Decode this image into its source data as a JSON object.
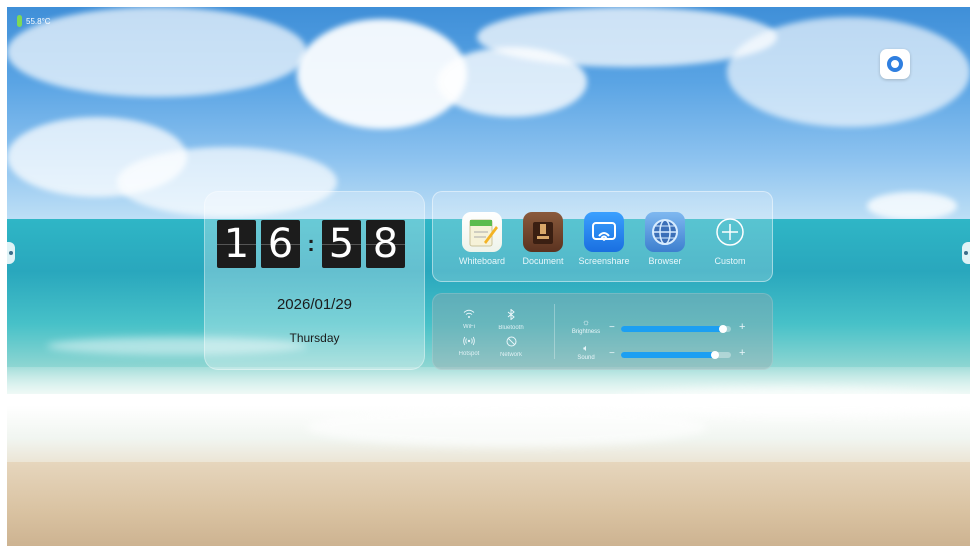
{
  "status": {
    "temperature": "55.8°C"
  },
  "clock": {
    "h1": "1",
    "h2": "6",
    "colon": ":",
    "m1": "5",
    "m2": "8",
    "date": "2026/01/29",
    "weekday": "Thursday"
  },
  "apps": [
    {
      "label": "Whiteboard",
      "icon": "whiteboard-icon"
    },
    {
      "label": "Document",
      "icon": "document-icon"
    },
    {
      "label": "Screenshare",
      "icon": "screenshare-icon"
    },
    {
      "label": "Browser",
      "icon": "browser-icon"
    },
    {
      "label": "Custom",
      "icon": "add-icon"
    }
  ],
  "quick_settings": [
    {
      "label": "WiFi",
      "icon": "wifi-icon"
    },
    {
      "label": "Bluetooth",
      "icon": "bluetooth-icon"
    },
    {
      "label": "Hotspot",
      "icon": "hotspot-icon"
    },
    {
      "label": "Network",
      "icon": "network-icon"
    }
  ],
  "sliders": {
    "brightness": {
      "label": "Brightness",
      "icon": "sun-icon",
      "value": 0.93
    },
    "sound": {
      "label": "Sound",
      "icon": "speaker-icon",
      "value": 0.85
    }
  },
  "colors": {
    "slider_fill": "#1c9ff2",
    "accent_camera": "#2f7fe0",
    "battery": "#7ed957"
  }
}
